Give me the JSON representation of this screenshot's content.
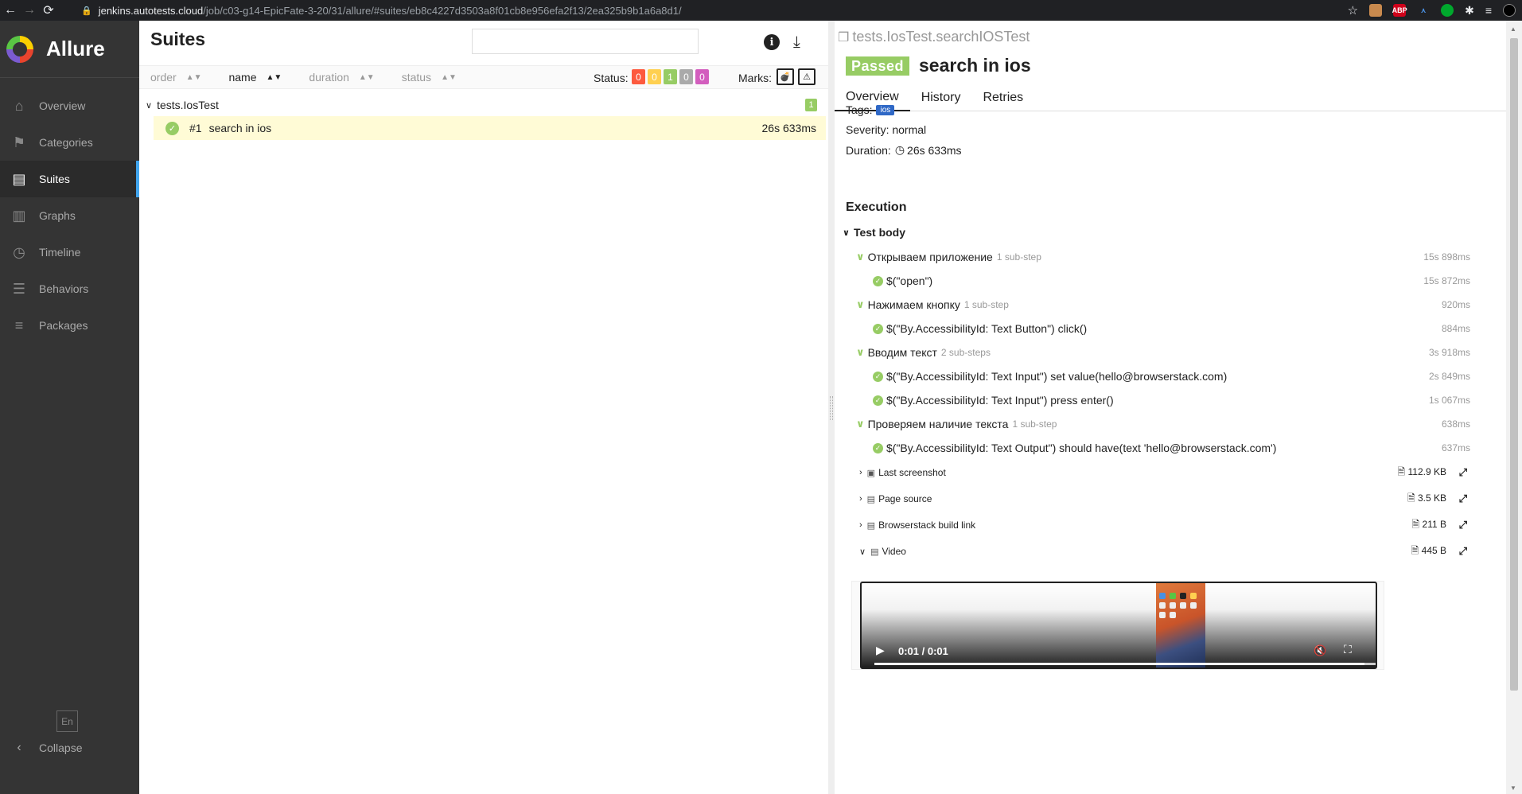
{
  "browser": {
    "url_host": "jenkins.autotests.cloud",
    "url_path": "/job/c03-g14-EpicFate-3-20/31/allure/#suites/eb8c4227d3503a8f01cb8e956efa2f13/2ea325b9b1a6a8d1/"
  },
  "sidebar": {
    "brand": "Allure",
    "items": [
      {
        "label": "Overview",
        "icon": "home-icon"
      },
      {
        "label": "Categories",
        "icon": "flag-icon"
      },
      {
        "label": "Suites",
        "icon": "briefcase-icon"
      },
      {
        "label": "Graphs",
        "icon": "bar-chart-icon"
      },
      {
        "label": "Timeline",
        "icon": "clock-icon"
      },
      {
        "label": "Behaviors",
        "icon": "list-icon"
      },
      {
        "label": "Packages",
        "icon": "align-icon"
      }
    ],
    "active_item": "Suites",
    "language": "En",
    "collapse_label": "Collapse"
  },
  "suites": {
    "title": "Suites",
    "search_placeholder": "",
    "sort": {
      "order": "order",
      "name": "name",
      "duration": "duration",
      "status": "status"
    },
    "status_label": "Status:",
    "status_counts": [
      {
        "value": "0",
        "color": "#fd5a3e",
        "status": "failed"
      },
      {
        "value": "0",
        "color": "#ffd050",
        "status": "broken"
      },
      {
        "value": "1",
        "color": "#97cc64",
        "status": "passed"
      },
      {
        "value": "0",
        "color": "#aaaaaa",
        "status": "skipped"
      },
      {
        "value": "0",
        "color": "#d35ebe",
        "status": "unknown"
      }
    ],
    "marks_label": "Marks:",
    "group": {
      "name": "tests.IosTest",
      "count": "1"
    },
    "row": {
      "order": "#1",
      "name": "search in ios",
      "duration": "26s 633ms"
    }
  },
  "detail": {
    "path": "tests.IosTest.searchIOSTest",
    "status": "Passed",
    "name": "search in ios",
    "tabs": [
      "Overview",
      "History",
      "Retries"
    ],
    "tags_label": "Tags:",
    "tag": "ios",
    "severity": "Severity: normal",
    "duration_label": "Duration:",
    "duration": "26s 633ms",
    "execution_title": "Execution",
    "test_body": "Test body",
    "steps": [
      {
        "name": "Открываем приложение",
        "sub": "1 sub-step",
        "time": "15s 898ms",
        "children": [
          {
            "name": "$(\"open\")",
            "time": "15s 872ms"
          }
        ]
      },
      {
        "name": "Нажимаем кнопку",
        "sub": "1 sub-step",
        "time": "920ms",
        "children": [
          {
            "name": "$(\"By.AccessibilityId: Text Button\") click()",
            "time": "884ms"
          }
        ]
      },
      {
        "name": "Вводим текст",
        "sub": "2 sub-steps",
        "time": "3s 918ms",
        "children": [
          {
            "name": "$(\"By.AccessibilityId: Text Input\") set value(hello@browserstack.com)",
            "time": "2s 849ms"
          },
          {
            "name": "$(\"By.AccessibilityId: Text Input\") press enter()",
            "time": "1s 067ms"
          }
        ]
      },
      {
        "name": "Проверяем наличие текста",
        "sub": "1 sub-step",
        "time": "638ms",
        "children": [
          {
            "name": "$(\"By.AccessibilityId: Text Output\") should have(text 'hello@browserstack.com')",
            "time": "637ms"
          }
        ]
      }
    ],
    "attachments": [
      {
        "name": "Last screenshot",
        "size": "112.9 KB",
        "expanded": false
      },
      {
        "name": "Page source",
        "size": "3.5 KB",
        "expanded": false
      },
      {
        "name": "Browserstack build link",
        "size": "211 B",
        "expanded": false
      },
      {
        "name": "Video",
        "size": "445 B",
        "expanded": true
      }
    ],
    "video": {
      "time": "0:01 / 0:01",
      "progress": 0.975
    }
  }
}
